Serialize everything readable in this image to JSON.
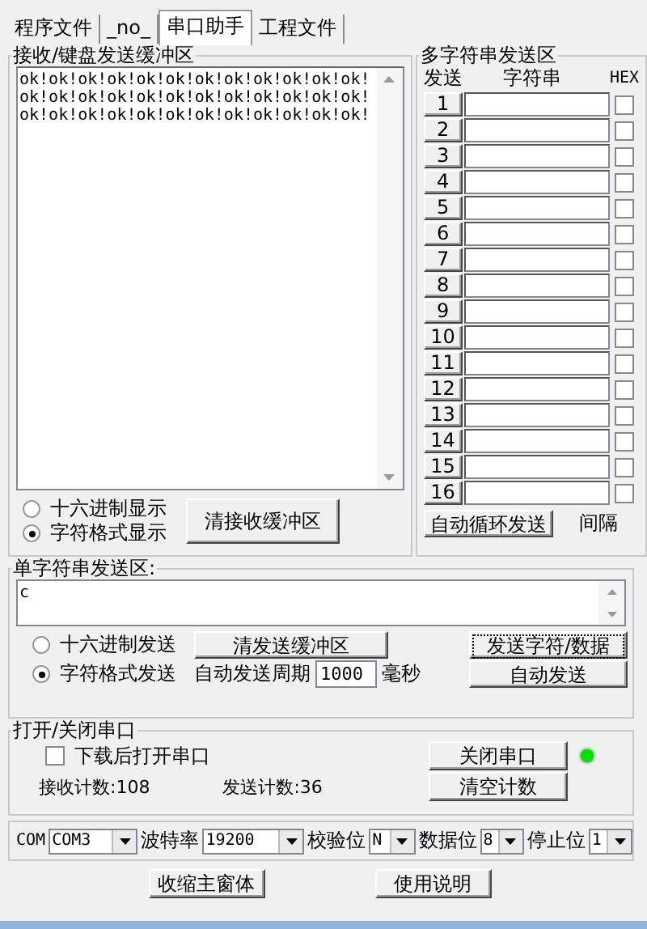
{
  "tabs": [
    {
      "label": "程序文件",
      "selected": false
    },
    {
      "label": "_no_",
      "selected": false
    },
    {
      "label": "串口助手",
      "selected": true
    },
    {
      "label": "工程文件",
      "selected": false
    }
  ],
  "receive": {
    "title": "接收/键盘发送缓冲区",
    "lines": [
      "ok!ok!ok!ok!ok!ok!ok!ok!ok!ok!ok!ok!",
      "ok!ok!ok!ok!ok!ok!ok!ok!ok!ok!ok!ok!",
      "ok!ok!ok!ok!ok!ok!ok!ok!ok!ok!ok!ok!"
    ],
    "modes": [
      {
        "label": "十六进制显示",
        "selected": false
      },
      {
        "label": "字符格式显示",
        "selected": true
      }
    ],
    "clear_button": "清接收缓冲区"
  },
  "multi": {
    "title": "多字符串发送区",
    "headers": [
      "发送",
      "字符串",
      "HEX"
    ],
    "rows": [
      {
        "label": "1",
        "hex": false
      },
      {
        "label": "2",
        "hex": false
      },
      {
        "label": "3",
        "hex": false
      },
      {
        "label": "4",
        "hex": false
      },
      {
        "label": "5",
        "hex": false
      },
      {
        "label": "6",
        "hex": false
      },
      {
        "label": "7",
        "hex": false
      },
      {
        "label": "8",
        "hex": false
      },
      {
        "label": "9",
        "hex": false
      },
      {
        "label": "10",
        "hex": false
      },
      {
        "label": "11",
        "hex": false
      },
      {
        "label": "12",
        "hex": false
      },
      {
        "label": "13",
        "hex": false
      },
      {
        "label": "14",
        "hex": false
      },
      {
        "label": "15",
        "hex": false
      },
      {
        "label": "16",
        "hex": false
      }
    ],
    "loop_button": "自动循环发送",
    "interval_label": "间隔"
  },
  "single": {
    "title": "单字符串发送区:",
    "value": "c",
    "modes": [
      {
        "label": "十六进制发送",
        "selected": false
      },
      {
        "label": "字符格式发送",
        "selected": true
      }
    ],
    "clear_button": "清发送缓冲区",
    "send_button": "发送字符/数据",
    "period_label": "自动发送周期",
    "period_value": "1000",
    "unit": "毫秒",
    "auto_button": "自动发送"
  },
  "port": {
    "title": "打开/关闭串口",
    "open_after_download": {
      "label": "下载后打开串口",
      "checked": false
    },
    "rx_count": "接收计数:108",
    "tx_count": "发送计数:36",
    "close_button": "关闭串口",
    "led_on": true,
    "clear_button": "清空计数"
  },
  "settings": [
    {
      "label": "COM",
      "value": "COM3"
    },
    {
      "label": "波特率",
      "value": "19200"
    },
    {
      "label": "校验位",
      "value": "N"
    },
    {
      "label": "数据位",
      "value": "8"
    },
    {
      "label": "停止位",
      "value": "1"
    }
  ],
  "bottom_buttons": [
    "收缩主窗体",
    "使用说明"
  ]
}
